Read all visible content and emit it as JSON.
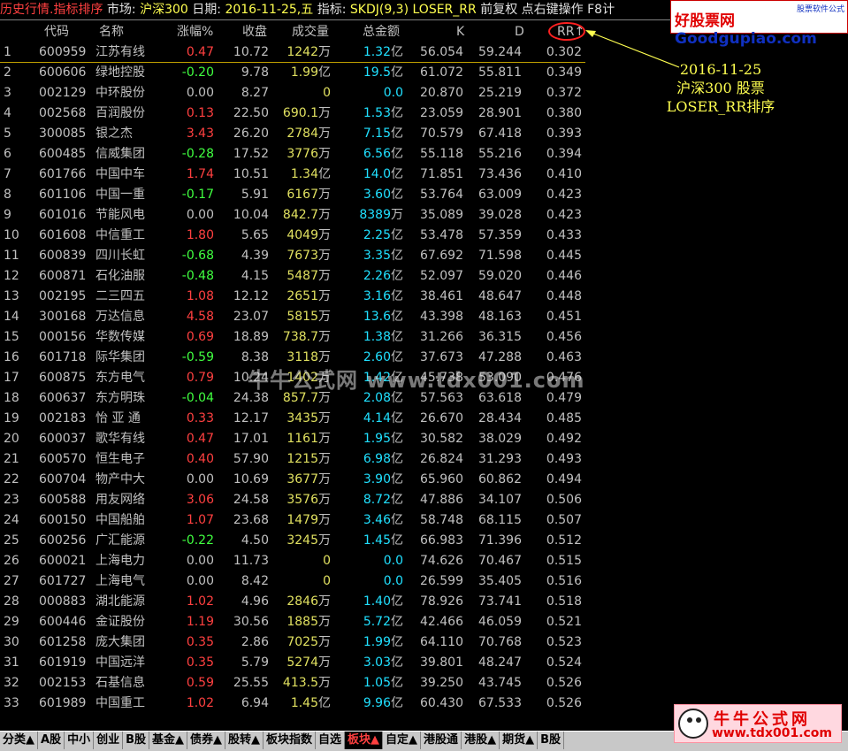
{
  "titlebar": {
    "title": "历史行情.指标排序",
    "market_label": "市场:",
    "market_value": "沪深300",
    "date_label": "日期:",
    "date_value": "2016-11-25,五",
    "indicator_label": "指标:",
    "indicator_value": "SKDJ(9,3)",
    "indicator_line": "LOSER_RR",
    "adjust": "前复权",
    "hint": "点右键操作",
    "f8": "F8计"
  },
  "logo": {
    "brand_cn": "好股票网",
    "brand_en": "Goodgupiao.com",
    "sub": "股票软件公式"
  },
  "columns": {
    "code": "代码",
    "name": "名称",
    "chg": "涨幅%",
    "close": "收盘",
    "vol": "成交量",
    "amt": "总金额",
    "k": "K",
    "d": "D",
    "rr": "RR↑"
  },
  "rows": [
    {
      "i": "1",
      "code": "600959",
      "name": "江苏有线",
      "chg": "0.47",
      "dir": "up",
      "close": "10.72",
      "vol": "1242",
      "volu": "万",
      "amt": "1.32",
      "amtu": "亿",
      "k": "56.054",
      "d": "59.244",
      "rr": "0.302"
    },
    {
      "i": "2",
      "code": "600606",
      "name": "绿地控股",
      "chg": "-0.20",
      "dir": "down",
      "close": "9.78",
      "vol": "1.99",
      "volu": "亿",
      "amt": "19.5",
      "amtu": "亿",
      "k": "61.072",
      "d": "55.811",
      "rr": "0.349"
    },
    {
      "i": "3",
      "code": "002129",
      "name": "中环股份",
      "chg": "0.00",
      "dir": "flat",
      "close": "8.27",
      "vol": "0",
      "volu": "",
      "amt": "0.0",
      "amtu": "",
      "k": "20.870",
      "d": "25.219",
      "rr": "0.372"
    },
    {
      "i": "4",
      "code": "002568",
      "name": "百润股份",
      "chg": "0.13",
      "dir": "up",
      "close": "22.50",
      "vol": "690.1",
      "volu": "万",
      "amt": "1.53",
      "amtu": "亿",
      "k": "23.059",
      "d": "28.901",
      "rr": "0.380"
    },
    {
      "i": "5",
      "code": "300085",
      "name": "银之杰",
      "chg": "3.43",
      "dir": "up",
      "close": "26.20",
      "vol": "2784",
      "volu": "万",
      "amt": "7.15",
      "amtu": "亿",
      "k": "70.579",
      "d": "67.418",
      "rr": "0.393"
    },
    {
      "i": "6",
      "code": "600485",
      "name": "信威集团",
      "chg": "-0.28",
      "dir": "down",
      "close": "17.52",
      "vol": "3776",
      "volu": "万",
      "amt": "6.56",
      "amtu": "亿",
      "k": "55.118",
      "d": "55.216",
      "rr": "0.394"
    },
    {
      "i": "7",
      "code": "601766",
      "name": "中国中车",
      "chg": "1.74",
      "dir": "up",
      "close": "10.51",
      "vol": "1.34",
      "volu": "亿",
      "amt": "14.0",
      "amtu": "亿",
      "k": "71.851",
      "d": "73.436",
      "rr": "0.410"
    },
    {
      "i": "8",
      "code": "601106",
      "name": "中国一重",
      "chg": "-0.17",
      "dir": "down",
      "close": "5.91",
      "vol": "6167",
      "volu": "万",
      "amt": "3.60",
      "amtu": "亿",
      "k": "53.764",
      "d": "63.009",
      "rr": "0.423"
    },
    {
      "i": "9",
      "code": "601016",
      "name": "节能风电",
      "chg": "0.00",
      "dir": "flat",
      "close": "10.04",
      "vol": "842.7",
      "volu": "万",
      "amt": "8389",
      "amtu": "万",
      "k": "35.089",
      "d": "39.028",
      "rr": "0.423"
    },
    {
      "i": "10",
      "code": "601608",
      "name": "中信重工",
      "chg": "1.80",
      "dir": "up",
      "close": "5.65",
      "vol": "4049",
      "volu": "万",
      "amt": "2.25",
      "amtu": "亿",
      "k": "53.478",
      "d": "57.359",
      "rr": "0.433"
    },
    {
      "i": "11",
      "code": "600839",
      "name": "四川长虹",
      "chg": "-0.68",
      "dir": "down",
      "close": "4.39",
      "vol": "7673",
      "volu": "万",
      "amt": "3.35",
      "amtu": "亿",
      "k": "67.692",
      "d": "71.598",
      "rr": "0.445"
    },
    {
      "i": "12",
      "code": "600871",
      "name": "石化油服",
      "chg": "-0.48",
      "dir": "down",
      "close": "4.15",
      "vol": "5487",
      "volu": "万",
      "amt": "2.26",
      "amtu": "亿",
      "k": "52.097",
      "d": "59.020",
      "rr": "0.446"
    },
    {
      "i": "13",
      "code": "002195",
      "name": "二三四五",
      "chg": "1.08",
      "dir": "up",
      "close": "12.12",
      "vol": "2651",
      "volu": "万",
      "amt": "3.16",
      "amtu": "亿",
      "k": "38.461",
      "d": "48.647",
      "rr": "0.448"
    },
    {
      "i": "14",
      "code": "300168",
      "name": "万达信息",
      "chg": "4.58",
      "dir": "up",
      "close": "23.07",
      "vol": "5815",
      "volu": "万",
      "amt": "13.6",
      "amtu": "亿",
      "k": "43.398",
      "d": "48.163",
      "rr": "0.451"
    },
    {
      "i": "15",
      "code": "000156",
      "name": "华数传媒",
      "chg": "0.69",
      "dir": "up",
      "close": "18.89",
      "vol": "738.7",
      "volu": "万",
      "amt": "1.38",
      "amtu": "亿",
      "k": "31.266",
      "d": "36.315",
      "rr": "0.456"
    },
    {
      "i": "16",
      "code": "601718",
      "name": "际华集团",
      "chg": "-0.59",
      "dir": "down",
      "close": "8.38",
      "vol": "3118",
      "volu": "万",
      "amt": "2.60",
      "amtu": "亿",
      "k": "37.673",
      "d": "47.288",
      "rr": "0.463"
    },
    {
      "i": "17",
      "code": "600875",
      "name": "东方电气",
      "chg": "0.79",
      "dir": "up",
      "close": "10.24",
      "vol": "1402",
      "volu": "万",
      "amt": "1.42",
      "amtu": "亿",
      "k": "45.738",
      "d": "53.090",
      "rr": "0.476"
    },
    {
      "i": "18",
      "code": "600637",
      "name": "东方明珠",
      "chg": "-0.04",
      "dir": "down",
      "close": "24.38",
      "vol": "857.7",
      "volu": "万",
      "amt": "2.08",
      "amtu": "亿",
      "k": "57.563",
      "d": "63.618",
      "rr": "0.479"
    },
    {
      "i": "19",
      "code": "002183",
      "name": "怡 亚 通",
      "chg": "0.33",
      "dir": "up",
      "close": "12.17",
      "vol": "3435",
      "volu": "万",
      "amt": "4.14",
      "amtu": "亿",
      "k": "26.670",
      "d": "28.434",
      "rr": "0.485"
    },
    {
      "i": "20",
      "code": "600037",
      "name": "歌华有线",
      "chg": "0.47",
      "dir": "up",
      "close": "17.01",
      "vol": "1161",
      "volu": "万",
      "amt": "1.95",
      "amtu": "亿",
      "k": "30.582",
      "d": "38.029",
      "rr": "0.492"
    },
    {
      "i": "21",
      "code": "600570",
      "name": "恒生电子",
      "chg": "0.40",
      "dir": "up",
      "close": "57.90",
      "vol": "1215",
      "volu": "万",
      "amt": "6.98",
      "amtu": "亿",
      "k": "26.824",
      "d": "31.293",
      "rr": "0.493"
    },
    {
      "i": "22",
      "code": "600704",
      "name": "物产中大",
      "chg": "0.00",
      "dir": "flat",
      "close": "10.69",
      "vol": "3677",
      "volu": "万",
      "amt": "3.90",
      "amtu": "亿",
      "k": "65.960",
      "d": "60.862",
      "rr": "0.494"
    },
    {
      "i": "23",
      "code": "600588",
      "name": "用友网络",
      "chg": "3.06",
      "dir": "up",
      "close": "24.58",
      "vol": "3576",
      "volu": "万",
      "amt": "8.72",
      "amtu": "亿",
      "k": "47.886",
      "d": "34.107",
      "rr": "0.506"
    },
    {
      "i": "24",
      "code": "600150",
      "name": "中国船舶",
      "chg": "1.07",
      "dir": "up",
      "close": "23.68",
      "vol": "1479",
      "volu": "万",
      "amt": "3.46",
      "amtu": "亿",
      "k": "58.748",
      "d": "68.115",
      "rr": "0.507"
    },
    {
      "i": "25",
      "code": "600256",
      "name": "广汇能源",
      "chg": "-0.22",
      "dir": "down",
      "close": "4.50",
      "vol": "3245",
      "volu": "万",
      "amt": "1.45",
      "amtu": "亿",
      "k": "66.983",
      "d": "71.396",
      "rr": "0.512"
    },
    {
      "i": "26",
      "code": "600021",
      "name": "上海电力",
      "chg": "0.00",
      "dir": "flat",
      "close": "11.73",
      "vol": "0",
      "volu": "",
      "amt": "0.0",
      "amtu": "",
      "k": "74.626",
      "d": "70.467",
      "rr": "0.515"
    },
    {
      "i": "27",
      "code": "601727",
      "name": "上海电气",
      "chg": "0.00",
      "dir": "flat",
      "close": "8.42",
      "vol": "0",
      "volu": "",
      "amt": "0.0",
      "amtu": "",
      "k": "26.599",
      "d": "35.405",
      "rr": "0.516"
    },
    {
      "i": "28",
      "code": "000883",
      "name": "湖北能源",
      "chg": "1.02",
      "dir": "up",
      "close": "4.96",
      "vol": "2846",
      "volu": "万",
      "amt": "1.40",
      "amtu": "亿",
      "k": "78.926",
      "d": "73.741",
      "rr": "0.518"
    },
    {
      "i": "29",
      "code": "600446",
      "name": "金证股份",
      "chg": "1.19",
      "dir": "up",
      "close": "30.56",
      "vol": "1885",
      "volu": "万",
      "amt": "5.72",
      "amtu": "亿",
      "k": "42.466",
      "d": "46.059",
      "rr": "0.521"
    },
    {
      "i": "30",
      "code": "601258",
      "name": "庞大集团",
      "chg": "0.35",
      "dir": "up",
      "close": "2.86",
      "vol": "7025",
      "volu": "万",
      "amt": "1.99",
      "amtu": "亿",
      "k": "64.110",
      "d": "70.768",
      "rr": "0.523"
    },
    {
      "i": "31",
      "code": "601919",
      "name": "中国远洋",
      "chg": "0.35",
      "dir": "up",
      "close": "5.79",
      "vol": "5274",
      "volu": "万",
      "amt": "3.03",
      "amtu": "亿",
      "k": "39.801",
      "d": "48.247",
      "rr": "0.524"
    },
    {
      "i": "32",
      "code": "002153",
      "name": "石基信息",
      "chg": "0.59",
      "dir": "up",
      "close": "25.55",
      "vol": "413.5",
      "volu": "万",
      "amt": "1.05",
      "amtu": "亿",
      "k": "39.250",
      "d": "43.745",
      "rr": "0.526"
    },
    {
      "i": "33",
      "code": "601989",
      "name": "中国重工",
      "chg": "1.02",
      "dir": "up",
      "close": "6.94",
      "vol": "1.45",
      "volu": "亿",
      "amt": "9.96",
      "amtu": "亿",
      "k": "60.430",
      "d": "67.533",
      "rr": "0.526"
    }
  ],
  "annotation": {
    "line1": "2016-11-25",
    "line2": "沪深300 股票",
    "line3": "LOSER_RR排序"
  },
  "watermark": "牛牛公式网 www.tdx001.com",
  "stamp": {
    "line1": "牛牛公式网",
    "line2": "www.tdx001.com"
  },
  "tabs": [
    "分类▲",
    "A股",
    "中小",
    "创业",
    "B股",
    "基金▲",
    "债券▲",
    "股转▲",
    "板块指数",
    "自选",
    "板块▲",
    "自定▲",
    "港股通",
    "港股▲",
    "期货▲",
    "B股"
  ],
  "active_tab": 10,
  "colors": {
    "up": "#ff4040",
    "down": "#40ff40",
    "volume": "#e0e060",
    "amount": "#20e0ff",
    "annotation": "#ffff50",
    "highlight_ring": "#ff2020"
  }
}
